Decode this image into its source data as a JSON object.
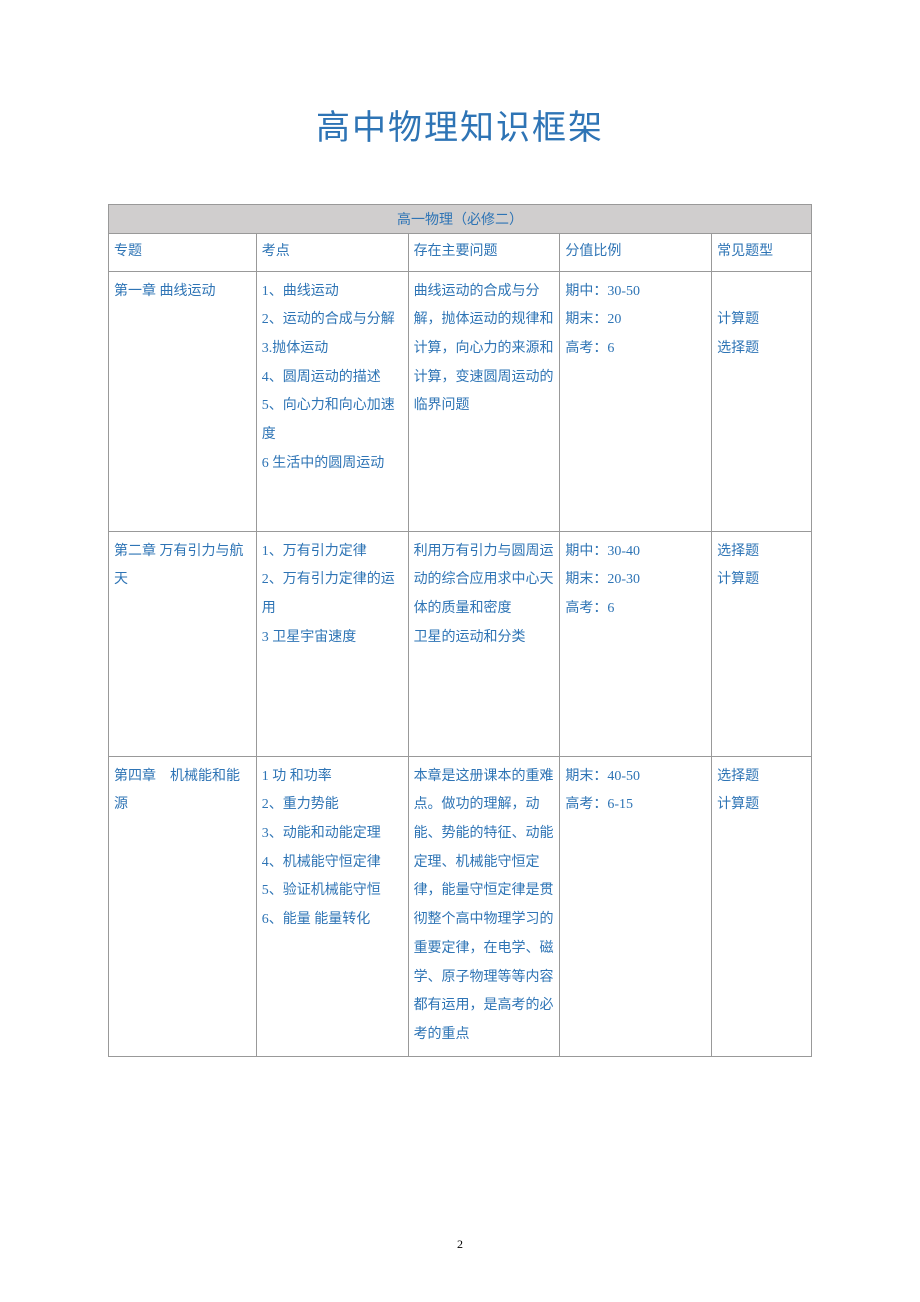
{
  "title": "高中物理知识框架",
  "table_header": "高一物理（必修二）",
  "columns": {
    "c1": "专题",
    "c2": "考点",
    "c3": "存在主要问题",
    "c4": "分值比例",
    "c5": "常见题型"
  },
  "rows": [
    {
      "topic": "第一章 曲线运动",
      "points": "1、曲线运动\n2、运动的合成与分解\n3.抛体运动\n4、圆周运动的描述\n5、向心力和向心加速度\n6 生活中的圆周运动",
      "problems": "曲线运动的合成与分解，抛体运动的规律和计算，向心力的来源和计算，变速圆周运动的临界问题",
      "score": "期中：30-50\n期末：20\n高考：6",
      "types": "\n计算题\n选择题"
    },
    {
      "topic": "第二章 万有引力与航天",
      "points": "1、万有引力定律\n2、万有引力定律的运用\n3 卫星宇宙速度",
      "problems": "利用万有引力与圆周运动的综合应用求中心天体的质量和密度\n卫星的运动和分类",
      "score": "期中：30-40\n期末：20-30\n高考：6",
      "types": "选择题\n计算题"
    },
    {
      "topic": "第四章　机械能和能源",
      "points": "1 功 和功率\n2、重力势能\n3、动能和动能定理\n4、机械能守恒定律\n 5、验证机械能守恒\n6、能量 能量转化",
      "problems": "本章是这册课本的重难点。做功的理解，动能、势能的特征、动能定理、机械能守恒定律，能量守恒定律是贯彻整个高中物理学习的重要定律，在电学、磁学、原子物理等等内容都有运用，是高考的必考的重点",
      "score": "期末：40-50\n高考：6-15",
      "types": "选择题\n计算题"
    }
  ],
  "page_number": "2"
}
